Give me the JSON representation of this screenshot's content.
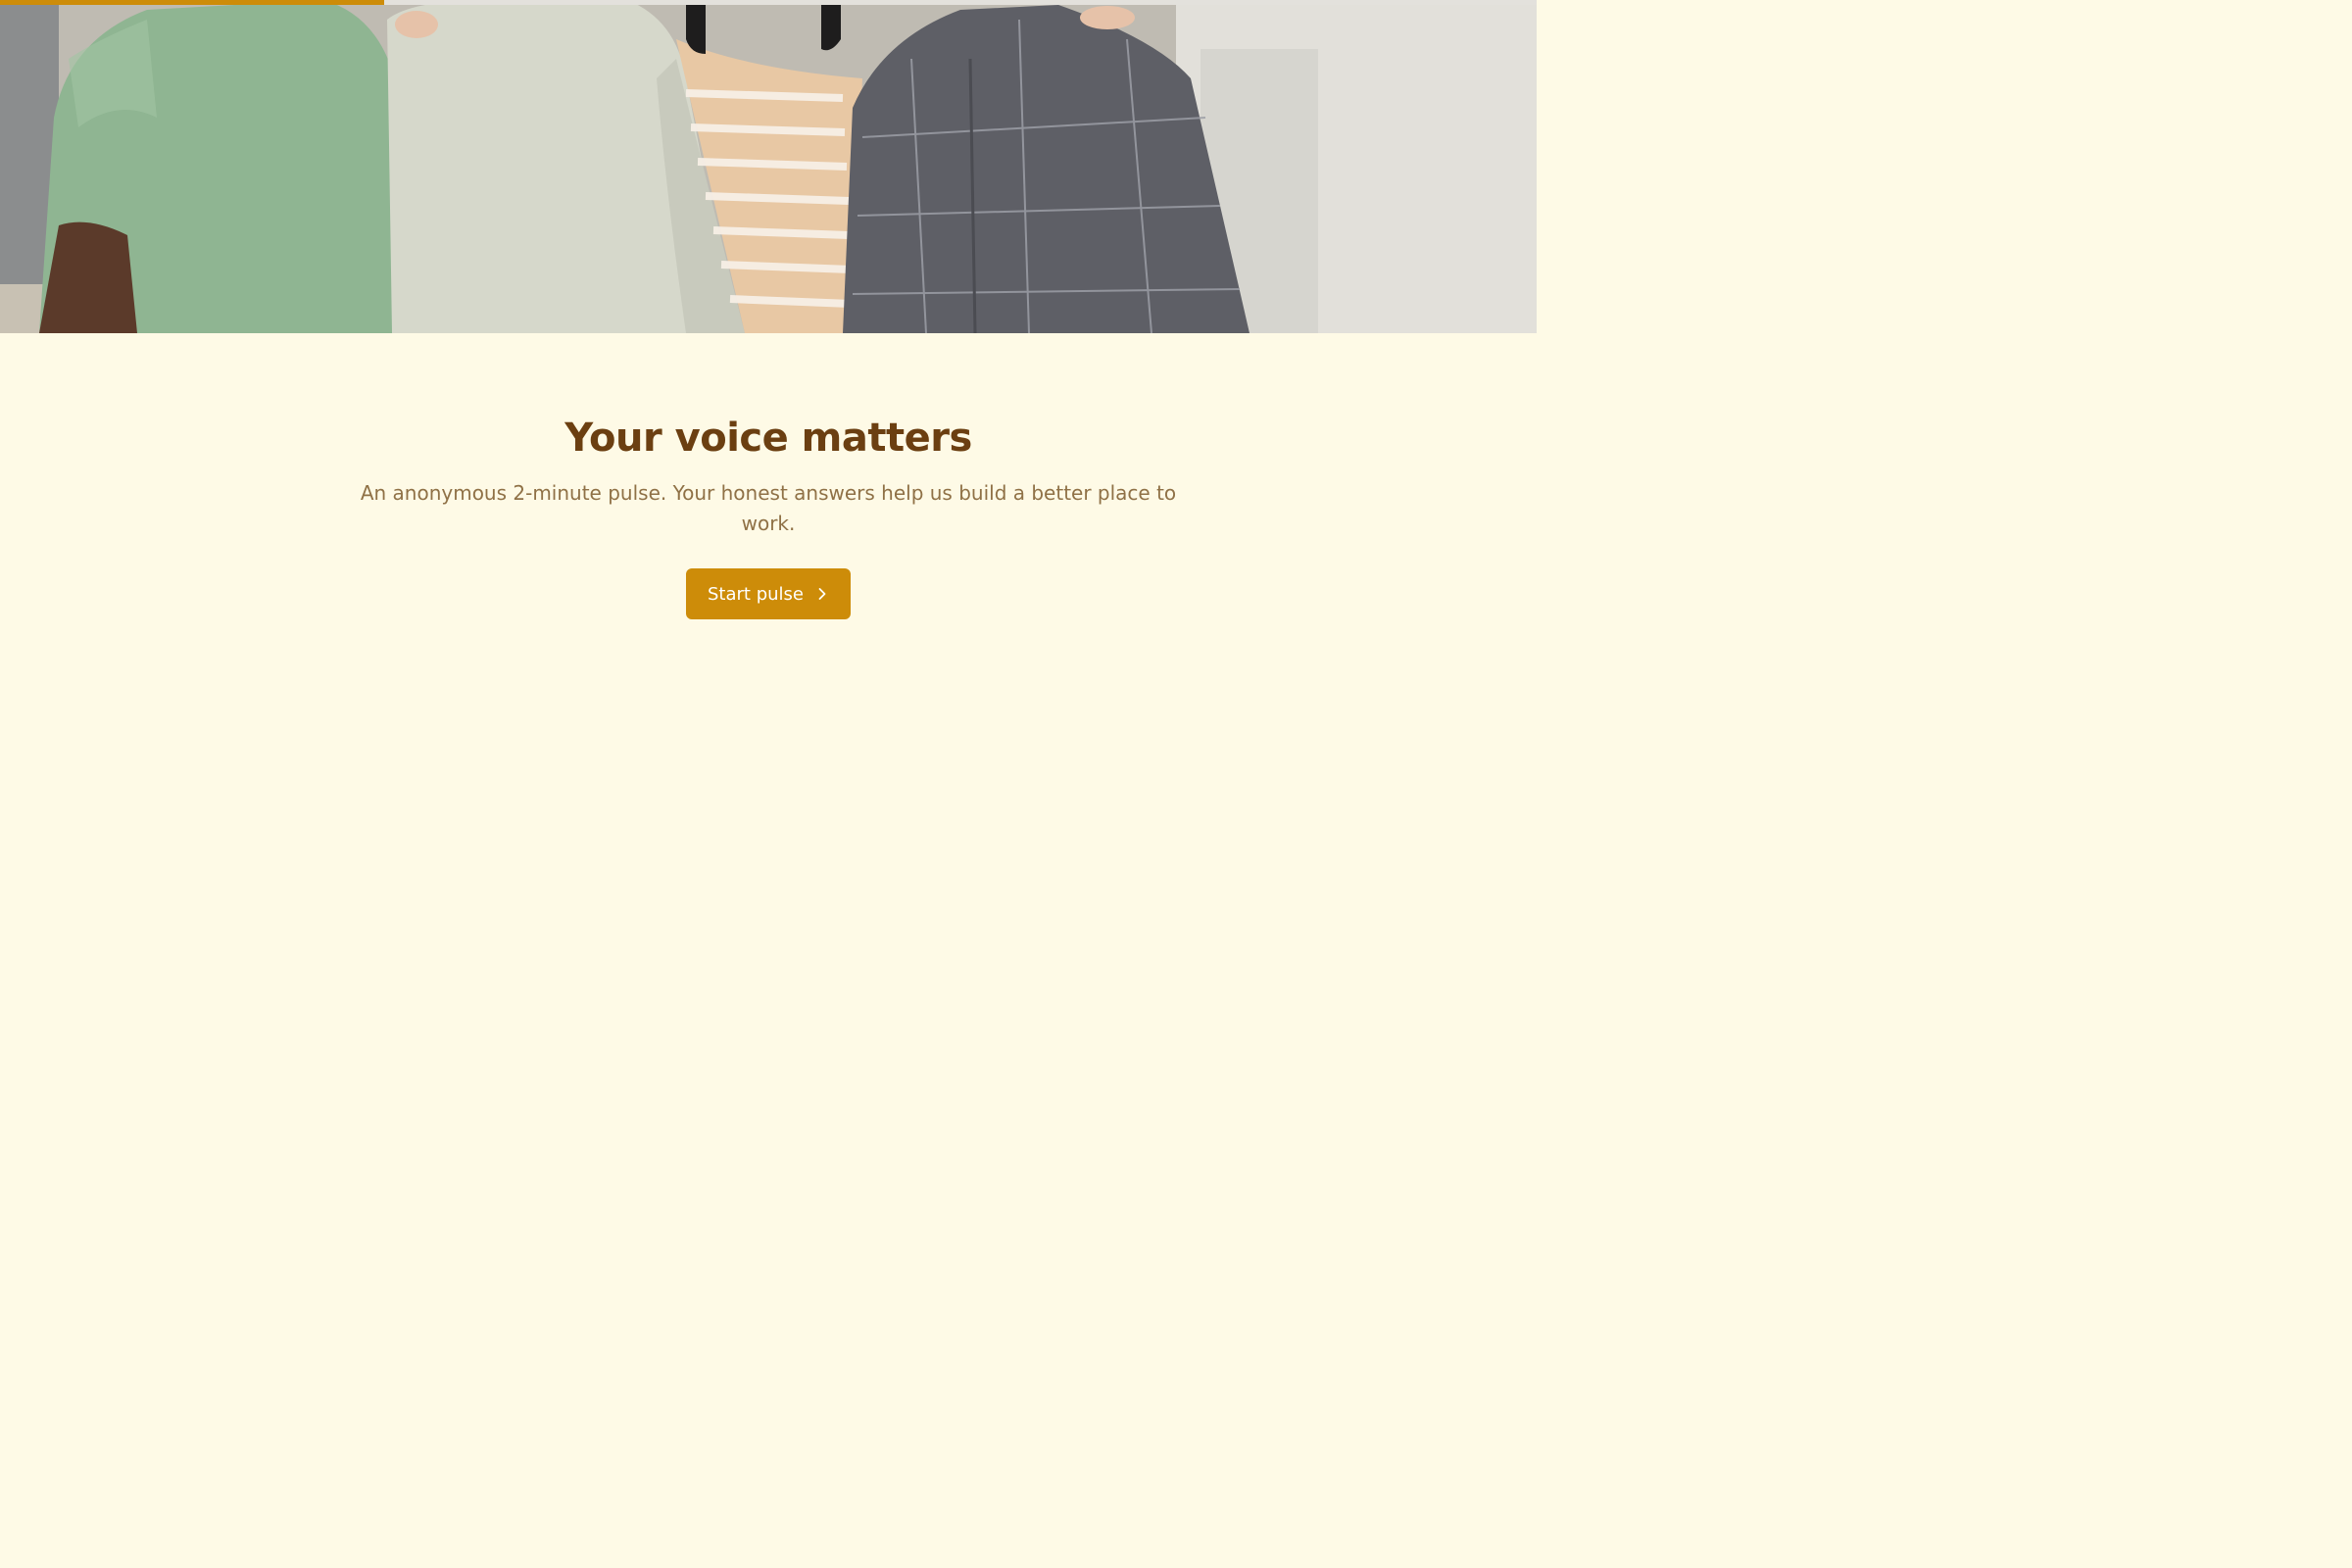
{
  "progress": {
    "fraction": 0.25
  },
  "hero": {
    "image": "group-of-coworkers-photo"
  },
  "main": {
    "title": "Your voice matters",
    "subtitle": "An anonymous 2-minute pulse. Your honest answers help us build a better place to work.",
    "start_button": {
      "label": "Start pulse",
      "icon": "chevron-right-icon"
    }
  },
  "colors": {
    "accent": "#cd8c09",
    "background": "#fefae6",
    "title": "#6b3f11",
    "subtitle": "#8f7146",
    "progress_track": "#e3e1dc"
  }
}
